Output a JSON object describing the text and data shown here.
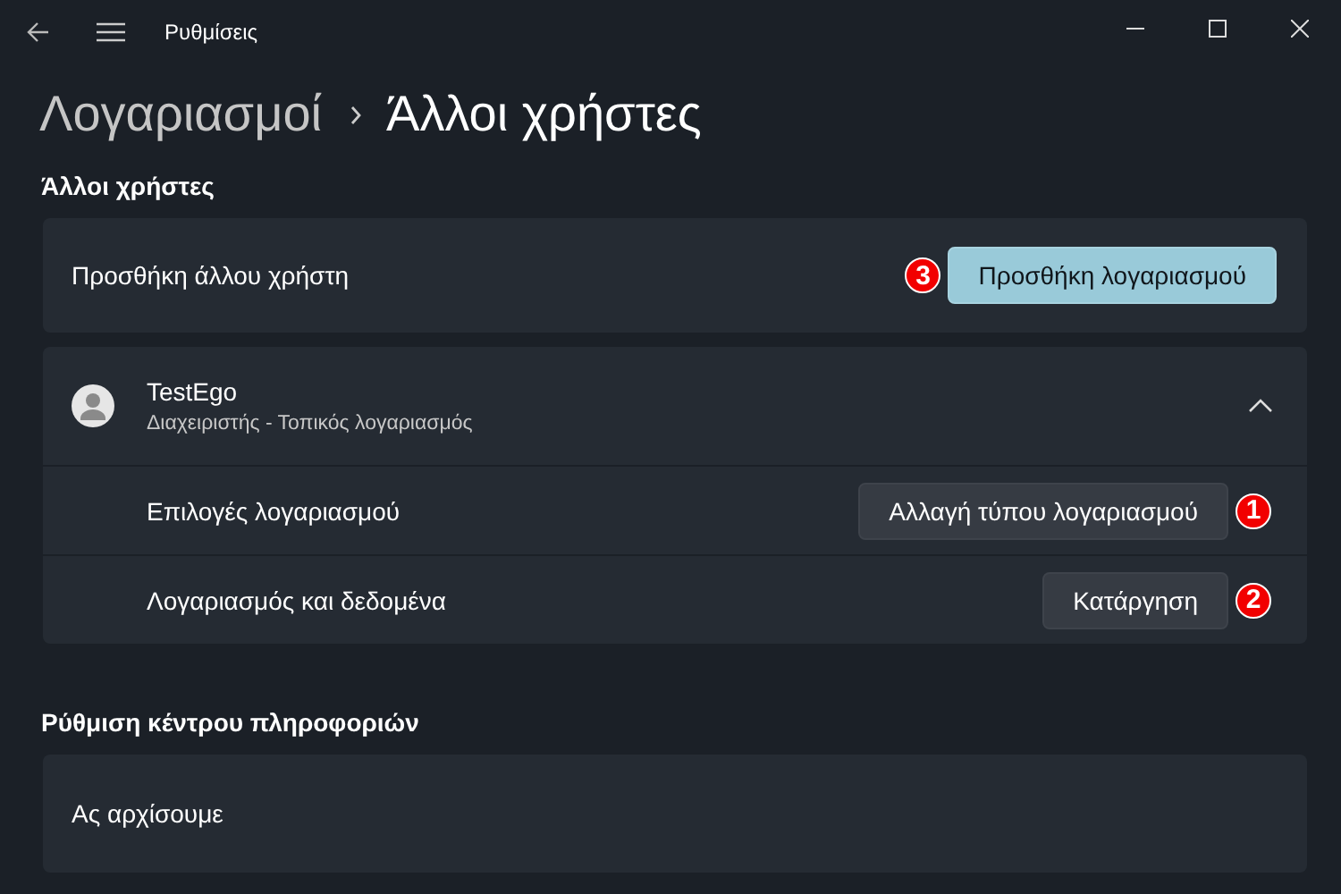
{
  "window": {
    "title": "Ρυθμίσεις"
  },
  "breadcrumb": [
    {
      "label": "Λογαριασμοί",
      "current": false
    },
    {
      "label": "Άλλοι χρήστες",
      "current": true
    }
  ],
  "sections": [
    {
      "heading": "Άλλοι χρήστες",
      "cards": [
        {
          "kind": "action",
          "label": "Προσθήκη άλλου χρήστη",
          "button": {
            "label": "Προσθήκη λογαριασμού",
            "accent": true,
            "marker": "3"
          }
        },
        {
          "kind": "user",
          "name": "TestEgo",
          "subtitle": "Διαχειριστής - Τοπικός λογαριασμός",
          "expanded": true,
          "rows": [
            {
              "label": "Επιλογές λογαριασμού",
              "button": {
                "label": "Αλλαγή τύπου λογαριασμού",
                "accent": false,
                "marker": "1"
              }
            },
            {
              "label": "Λογαριασμός και δεδομένα",
              "button": {
                "label": "Κατάργηση",
                "accent": false,
                "marker": "2"
              }
            }
          ]
        }
      ]
    },
    {
      "heading": "Ρύθμιση κέντρου πληροφοριών",
      "cards": [
        {
          "kind": "text",
          "label": "Ας αρχίσουμε"
        }
      ]
    }
  ]
}
